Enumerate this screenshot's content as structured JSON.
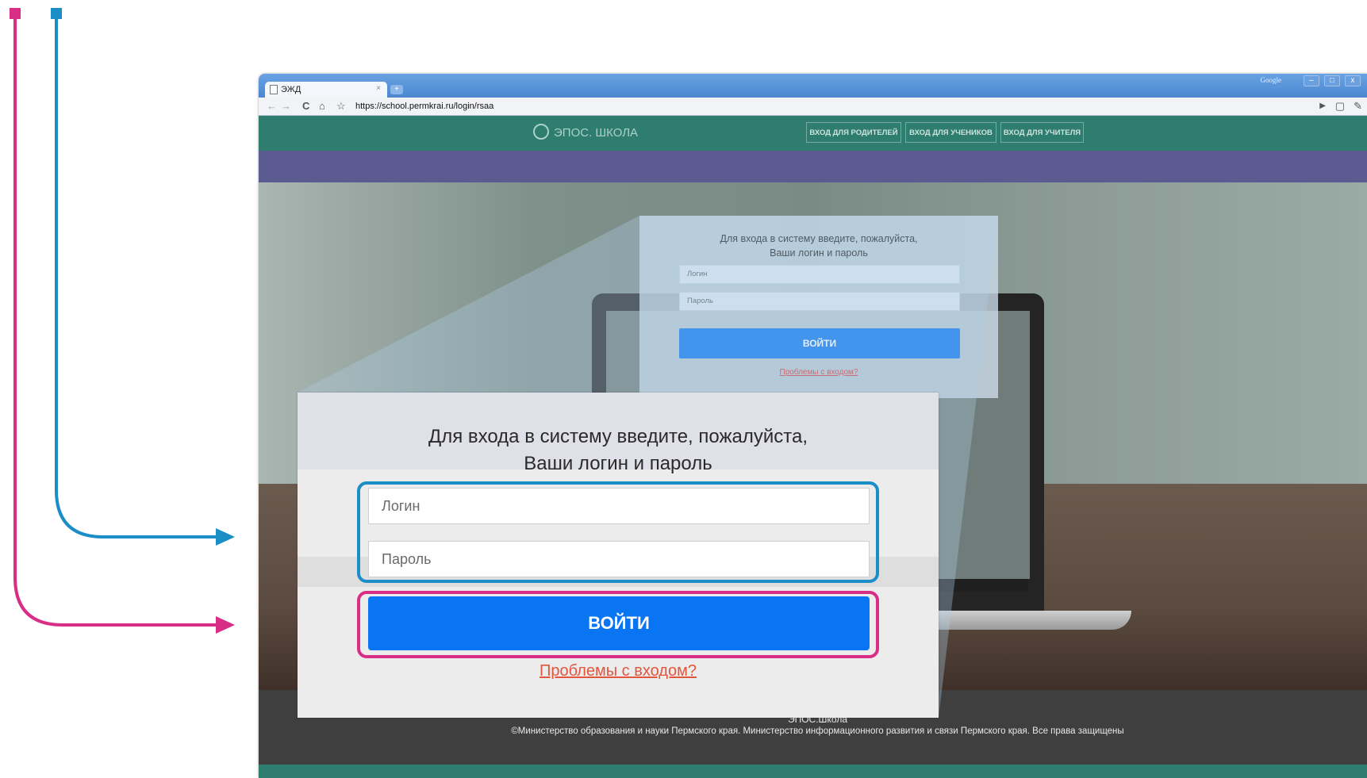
{
  "colors": {
    "annotation_pink": "#d92e86",
    "annotation_blue": "#1b8dc7",
    "header_green": "#2f7d6f",
    "band_purple": "#5b5b92",
    "button_blue": "#0a75f2",
    "link_red": "#e4553d"
  },
  "browser": {
    "tab_title": "ЭЖД",
    "tab_close": "×",
    "new_tab": "+",
    "window_label": "Google",
    "window_buttons": [
      "–",
      "□",
      "x"
    ],
    "url": "https://school.permkrai.ru/login/rsaa",
    "icons": [
      "back-icon",
      "forward-icon",
      "reload-icon",
      "home-icon",
      "star-icon",
      "play-icon",
      "page-icon",
      "wrench-icon"
    ]
  },
  "site": {
    "logo_text": "ЭПОС. ШКОЛА",
    "nav": [
      "ВХОД ДЛЯ РОДИТЕЛЕЙ",
      "ВХОД ДЛЯ УЧЕНИКОВ",
      "ВХОД ДЛЯ УЧИТЕЛЯ"
    ],
    "footer_line1": "ЭПОС.Школа",
    "footer_line2": "©Министерство образования и науки Пермского края. Министерство информационного развития и связи Пермского края. Все права защищены"
  },
  "login": {
    "prompt_line1": "Для входа в систему введите, пожалуйста,",
    "prompt_line2": "Ваши логин и пароль",
    "login_placeholder": "Логин",
    "password_placeholder": "Пароль",
    "submit_label": "ВОЙТИ",
    "problems_link": "Проблемы с входом?"
  }
}
